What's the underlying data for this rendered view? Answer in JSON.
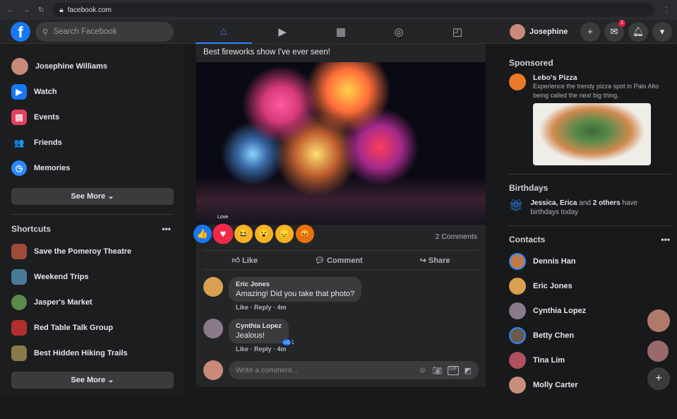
{
  "browser": {
    "url": "facebook.com"
  },
  "header": {
    "logo": "f",
    "search_placeholder": "Search Facebook",
    "user": "Josephine",
    "messenger_badge": "1",
    "tabs": [
      {
        "icon": "home-icon",
        "glyph": "⌂"
      },
      {
        "icon": "watch-icon",
        "glyph": "▶"
      },
      {
        "icon": "marketplace-icon",
        "glyph": "▦"
      },
      {
        "icon": "groups-icon",
        "glyph": "◎"
      },
      {
        "icon": "gaming-icon",
        "glyph": "◰"
      }
    ]
  },
  "sidebar": {
    "items": [
      {
        "label": "Josephine Williams"
      },
      {
        "label": "Watch",
        "color": "#1877f2",
        "glyph": "▶"
      },
      {
        "label": "Events",
        "color": "#e4405f",
        "glyph": "▤"
      },
      {
        "label": "Friends",
        "color": "#2d88ff",
        "glyph": "👥"
      },
      {
        "label": "Memories",
        "color": "#2d88ff",
        "glyph": "◷"
      }
    ],
    "see_more": "See More",
    "shortcuts_title": "Shortcuts",
    "more": "•••",
    "shortcuts": [
      {
        "label": "Save the Pomeroy Theatre",
        "color": "#a04a3a"
      },
      {
        "label": "Weekend Trips",
        "color": "#4a7a9a"
      },
      {
        "label": "Jasper's Market",
        "color": "#5a8a4a"
      },
      {
        "label": "Red Table Talk Group",
        "color": "#b03030"
      },
      {
        "label": "Best Hidden Hiking Trails",
        "color": "#8a7a4a"
      }
    ],
    "see_more2": "See More"
  },
  "post": {
    "caption": "Best fireworks show I've ever seen!",
    "tooltip": "Love",
    "comments_count": "2 Comments",
    "reactions": [
      {
        "name": "like",
        "color": "#1877f2",
        "glyph": "👍"
      },
      {
        "name": "love",
        "color": "#f02849",
        "glyph": "♥"
      },
      {
        "name": "haha",
        "color": "#f7b125",
        "glyph": "😆"
      },
      {
        "name": "wow",
        "color": "#f7b125",
        "glyph": "😮"
      },
      {
        "name": "sad",
        "color": "#f7b125",
        "glyph": "😞"
      },
      {
        "name": "angry",
        "color": "#e9710f",
        "glyph": "😡"
      }
    ],
    "like": "Like",
    "comment": "Comment",
    "share": "Share",
    "comments": [
      {
        "author": "Eric Jones",
        "text": "Amazing! Did you take that photo?",
        "meta": "Like · Reply · 4m"
      },
      {
        "author": "Cynthia Lopez",
        "text": "Jealous!",
        "meta": "Like · Reply · 4m",
        "reaction_count": "1"
      }
    ],
    "write_placeholder": "Write a comment...",
    "gif": "GIF"
  },
  "right": {
    "sponsored": "Sponsored",
    "ad_title": "Lebo's Pizza",
    "ad_text": "Experience the trendy pizza spot in Palo Alto being called the next big thing.",
    "birthdays": "Birthdays",
    "bday_names": "Jessica, Erica",
    "bday_and": " and ",
    "bday_others": "2 others",
    "bday_rest": " have birthdays today",
    "contacts_title": "Contacts",
    "more": "•••",
    "contacts": [
      {
        "name": "Dennis Han"
      },
      {
        "name": "Eric Jones"
      },
      {
        "name": "Cynthia Lopez"
      },
      {
        "name": "Betty Chen"
      },
      {
        "name": "Tina Lim"
      },
      {
        "name": "Molly Carter"
      }
    ]
  }
}
